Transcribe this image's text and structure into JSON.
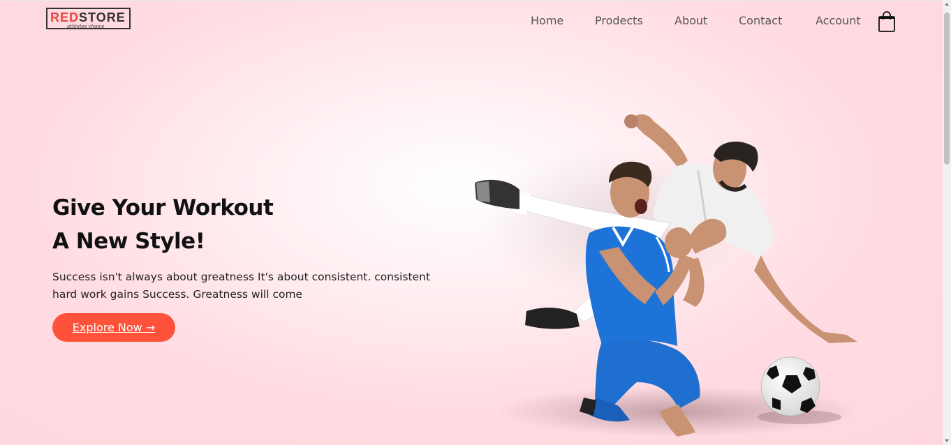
{
  "logo": {
    "part_red": "RED",
    "part_dark": "STORE",
    "tagline": "athletes choice"
  },
  "nav": {
    "items": [
      {
        "label": "Home"
      },
      {
        "label": "Prodects"
      },
      {
        "label": "About"
      },
      {
        "label": "Contact"
      },
      {
        "label": "Account"
      }
    ],
    "cart_icon": "shopping-bag-icon"
  },
  "hero": {
    "title_line1": "Give Your Workout",
    "title_line2": "A New Style!",
    "description": "Success isn't always about greatness It's about consistent. consistent hard work gains Success. Greatness will come",
    "cta_label": "Explore Now →"
  },
  "colors": {
    "accent": "#ff523b",
    "brand_red": "#e8483b",
    "background": "#ffd6df",
    "text": "#111111"
  }
}
